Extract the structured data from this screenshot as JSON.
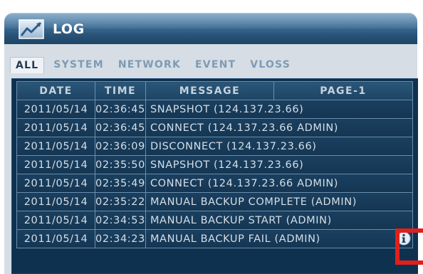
{
  "window": {
    "title": "LOG"
  },
  "tabs": [
    {
      "label": "ALL",
      "active": true
    },
    {
      "label": "SYSTEM",
      "active": false
    },
    {
      "label": "NETWORK",
      "active": false
    },
    {
      "label": "EVENT",
      "active": false
    },
    {
      "label": "VLOSS",
      "active": false
    }
  ],
  "table": {
    "headers": {
      "date": "DATE",
      "time": "TIME",
      "message": "MESSAGE",
      "page": "PAGE-1"
    },
    "rows": [
      {
        "date": "2011/05/14",
        "time": "02:36:45",
        "message": "SNAPSHOT (124.137.23.66)"
      },
      {
        "date": "2011/05/14",
        "time": "02:36:45",
        "message": "CONNECT (124.137.23.66 ADMIN)"
      },
      {
        "date": "2011/05/14",
        "time": "02:36:09",
        "message": "DISCONNECT (124.137.23.66)"
      },
      {
        "date": "2011/05/14",
        "time": "02:35:50",
        "message": "SNAPSHOT (124.137.23.66)"
      },
      {
        "date": "2011/05/14",
        "time": "02:35:49",
        "message": "CONNECT (124.137.23.66 ADMIN)"
      },
      {
        "date": "2011/05/14",
        "time": "02:35:22",
        "message": "MANUAL BACKUP COMPLETE (ADMIN)"
      },
      {
        "date": "2011/05/14",
        "time": "02:34:53",
        "message": "MANUAL BACKUP START (ADMIN)"
      },
      {
        "date": "2011/05/14",
        "time": "02:34:23",
        "message": "MANUAL BACKUP FAIL (ADMIN)"
      }
    ]
  },
  "icons": {
    "title": "chart-logo-icon",
    "row_info": "info-icon"
  },
  "colors": {
    "title_bar": "#3f6f98",
    "table_bg": "#143653",
    "highlight_box": "#e0201b"
  }
}
